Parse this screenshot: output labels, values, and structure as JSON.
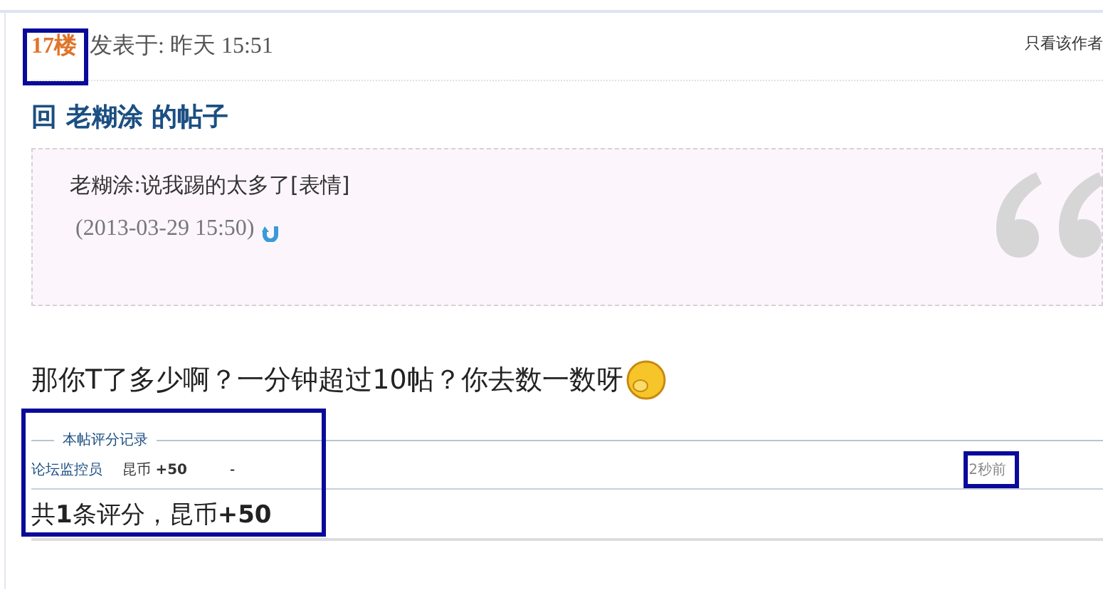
{
  "post": {
    "floor": {
      "label": "17楼",
      "highlighted": true
    },
    "posted": "发表于: 昨天 15:51",
    "author_only_link": "只看该作者",
    "title": "回 老糊涂 的帖子",
    "quote": {
      "text": "老糊涂:说我踢的太多了[表情]",
      "date": "(2013-03-29 15:50)"
    },
    "body": "那你T了多少啊？一分钟超过10帖？你去数一数呀",
    "ratings": {
      "legend": "本帖评分记录",
      "highlighted": true,
      "rows": [
        {
          "user": "论坛监控员",
          "score": "昆币 **+50**",
          "reason": "-",
          "time": "2秒前",
          "highlighted": true
        }
      ],
      "summary": "共**1**条评分，昆币**+50**"
    }
  }
}
